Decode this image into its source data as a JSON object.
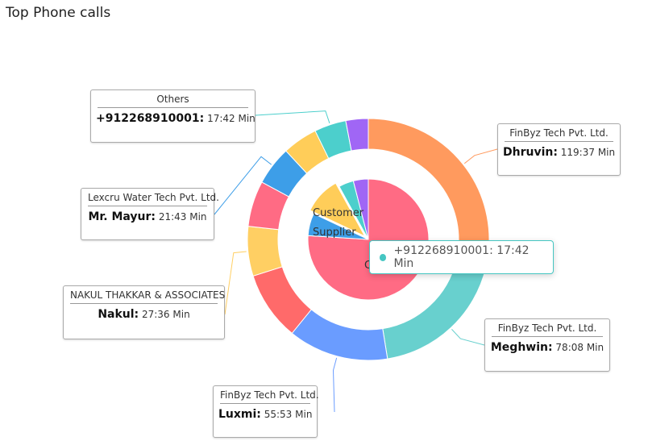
{
  "title": "Top Phone calls",
  "chart_data": {
    "type": "pie",
    "outer_ring": {
      "unit": "Min",
      "slices": [
        {
          "name": "Dhruvin",
          "company": "FinByz Tech Pvt. Ltd.",
          "value": 119.62,
          "display": "119:37 Min",
          "color": "#ff9a5e"
        },
        {
          "name": "Meghwin",
          "company": "FinByz Tech Pvt. Ltd.",
          "value": 78.13,
          "display": "78:08 Min",
          "color": "#68d0ce"
        },
        {
          "name": "Luxmi",
          "company": "FinByz Tech Pvt. Ltd.",
          "value": 55.88,
          "display": "55:53 Min",
          "color": "#6a9cff"
        },
        {
          "name": "",
          "company": "",
          "value": 38.5,
          "display": "",
          "color": "#ff6a6a"
        },
        {
          "name": "Nakul",
          "company": "NAKUL THAKKAR & ASSOCIATES",
          "value": 27.6,
          "display": "27:36 Min",
          "color": "#ffcf63"
        },
        {
          "name": "",
          "company": "",
          "value": 25.5,
          "display": "",
          "color": "#ff6b84"
        },
        {
          "name": "Mr. Mayur",
          "company": "Lexcru Water Tech Pvt. Ltd.",
          "value": 21.72,
          "display": "21:43 Min",
          "color": "#3d9ee8"
        },
        {
          "name": "",
          "company": "",
          "value": 19.5,
          "display": "",
          "color": "#ffcd59"
        },
        {
          "name": "+912268910001",
          "company": "Others",
          "value": 17.7,
          "display": "17:42 Min",
          "color": "#4ccfcc"
        },
        {
          "name": "",
          "company": "",
          "value": 12.5,
          "display": "",
          "color": "#a066f5"
        }
      ]
    },
    "inner_pie": {
      "slices": [
        {
          "name": "C",
          "value": 76,
          "color": "#ff6b84",
          "offset": false
        },
        {
          "name": "Supplier",
          "value": 6,
          "color": "#3d9ee8",
          "offset": false
        },
        {
          "name": "Customer",
          "value": 10,
          "color": "#ffcd59",
          "offset": true
        },
        {
          "name": "",
          "value": 4,
          "color": "#4ccfcc",
          "offset": false
        },
        {
          "name": "",
          "value": 4,
          "color": "#a066f5",
          "offset": false
        }
      ]
    }
  },
  "labels": {
    "dhruvin": {
      "company": "FinByz Tech Pvt. Ltd.",
      "name": "Dhruvin:",
      "time": "119:37 Min"
    },
    "meghwin": {
      "company": "FinByz Tech Pvt. Ltd.",
      "name": "Meghwin:",
      "time": "78:08 Min"
    },
    "luxmi": {
      "company": "FinByz Tech Pvt. Ltd.",
      "name": "Luxmi:",
      "time": "55:53 Min"
    },
    "nakul": {
      "company": "NAKUL THAKKAR & ASSOCIATES",
      "name": "Nakul:",
      "time": "27:36 Min"
    },
    "mayur": {
      "company": "Lexcru Water Tech Pvt. Ltd.",
      "name": "Mr. Mayur:",
      "time": "21:43 Min"
    },
    "others": {
      "company": "Others",
      "name": "+912268910001:",
      "time": "17:42 Min"
    }
  },
  "inner_labels": {
    "customer": "Customer",
    "supplier": "Supplier",
    "c": "C"
  },
  "tooltip": {
    "text": "+912268910001: 17:42 Min",
    "color": "#45c6c2"
  }
}
